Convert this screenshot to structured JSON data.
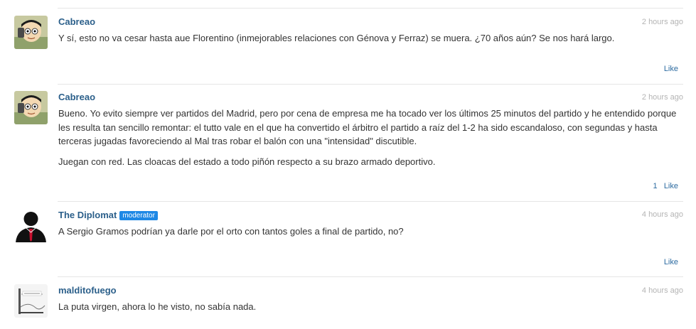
{
  "comments": [
    {
      "author": "Cabreao",
      "time": "2 hours ago",
      "paragraphs": [
        "Y sí, esto no va cesar hasta aue Florentino (inmejorables relaciones con Génova y Ferraz) se muera. ¿70 años aún? Se nos hará largo."
      ],
      "like_count": "",
      "like_label": "Like"
    },
    {
      "author": "Cabreao",
      "time": "2 hours ago",
      "paragraphs": [
        "Bueno. Yo evito siempre ver partidos del Madrid, pero por cena de empresa me ha tocado ver los últimos 25 minutos del partido y he entendido porque les resulta tan sencillo remontar: el tutto vale en el que ha convertido el árbitro el partido a raíz del 1-2 ha sido escandaloso, con segundas y hasta terceras jugadas favoreciendo al Mal tras robar el balón con una \"intensidad\" discutible.",
        "Juegan con red. Las cloacas del estado a todo piñón respecto a su brazo armado deportivo."
      ],
      "like_count": "1",
      "like_label": "Like"
    },
    {
      "author": "The Diplomat",
      "badge": "moderator",
      "time": "4 hours ago",
      "paragraphs": [
        "A Sergio Gramos podrían ya darle por el orto con tantos goles a final de partido, no?"
      ],
      "like_count": "",
      "like_label": "Like"
    },
    {
      "author": "malditofuego",
      "time": "4 hours ago",
      "paragraphs": [
        "La puta virgen, ahora lo he visto, no sabía nada."
      ]
    }
  ],
  "colors": {
    "author": "#2b5f8a",
    "link": "#2b6aa0",
    "badge": "#1e88e5",
    "timestamp": "#b4b4b4",
    "text": "#333333"
  }
}
